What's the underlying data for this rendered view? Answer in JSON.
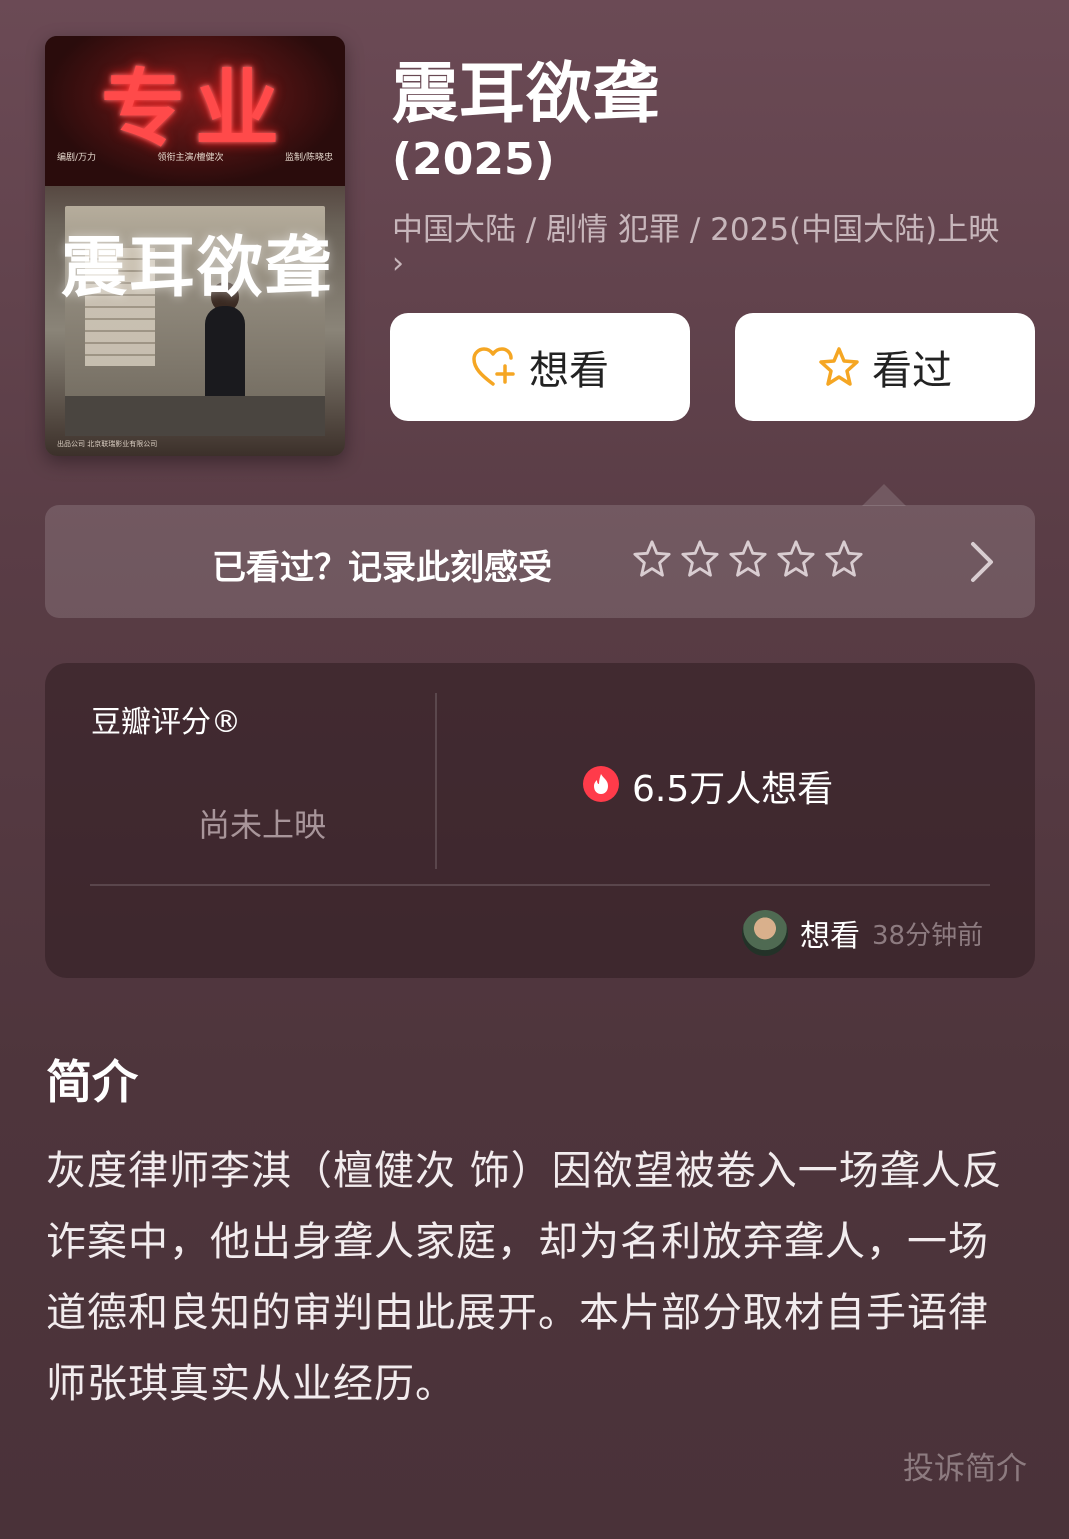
{
  "poster": {
    "sign_text": "专业",
    "title_art": "震耳欲聋",
    "credit_left": "编剧/万力",
    "credit_mid": "领衔主演/檀健次",
    "credit_right": "监制/陈晓忠",
    "bottom_credits": "出品公司  北京联瑞影业有限公司"
  },
  "movie": {
    "title": "震耳欲聋",
    "year": "(2025)",
    "meta": "中国大陆 / 剧情 犯罪 / 2025(中国大陆)上映",
    "meta_chevron": "›"
  },
  "actions": {
    "want_label": "想看",
    "seen_label": "看过"
  },
  "record": {
    "prompt": "已看过？记录此刻感受",
    "star_count": 5
  },
  "rating": {
    "label": "豆瓣评分®",
    "status": "尚未上映",
    "wish_count": "6.5万人想看",
    "recent_action": "想看",
    "recent_time": "38分钟前"
  },
  "synopsis": {
    "heading": "简介",
    "text": "灰度律师李淇（檀健次 饰）因欲望被卷入一场聋人反诈案中，他出身聋人家庭，却为名利放弃聋人，一场道德和良知的审判由此展开。本片部分取材自手语律师张琪真实从业经历。",
    "report_link": "投诉简介"
  },
  "colors": {
    "accent_orange": "#f5a623",
    "fire_red": "#ff3b4a",
    "background": "#5a3d46"
  }
}
